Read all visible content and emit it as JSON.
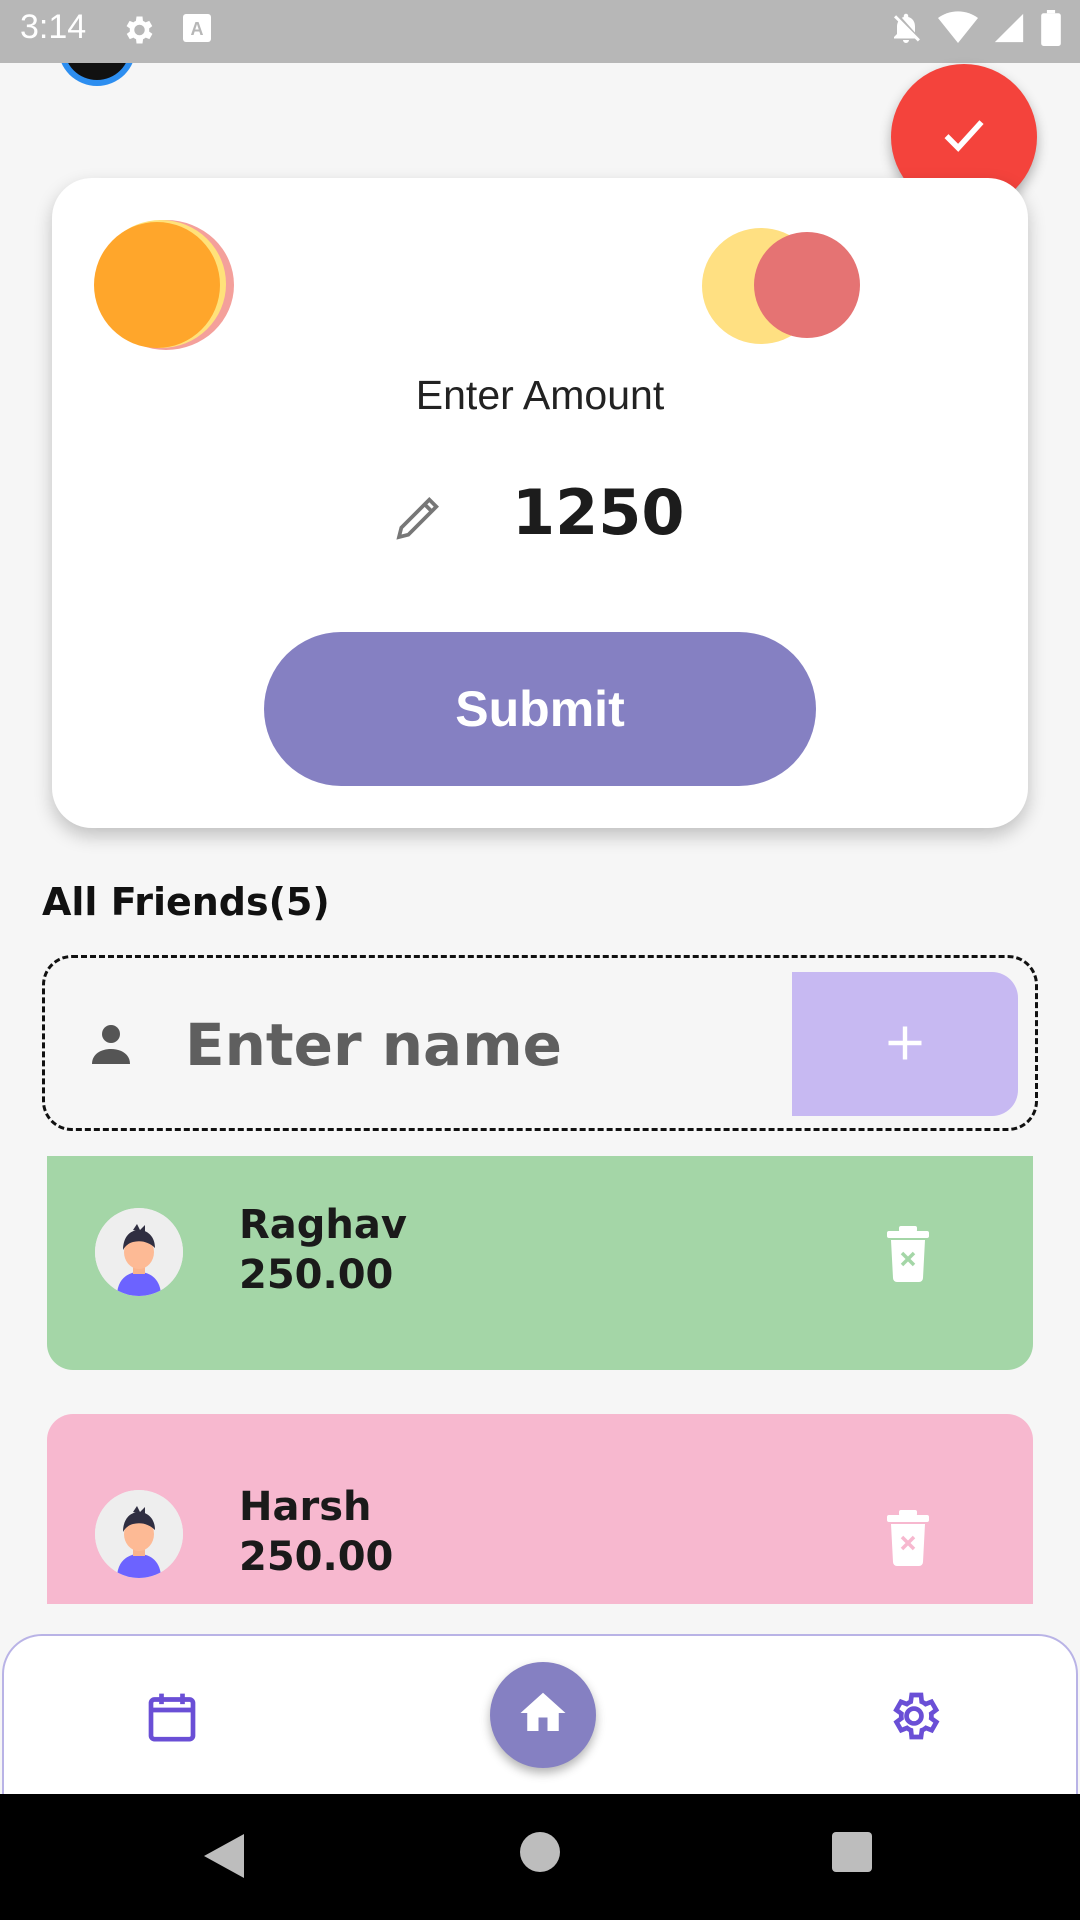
{
  "status_bar": {
    "time": "3:14",
    "icons_left": [
      "gear-icon",
      "keyboard-a-icon"
    ],
    "icons_right": [
      "bell-off-icon",
      "wifi-icon",
      "signal-icon",
      "battery-icon"
    ]
  },
  "fab": {
    "icon": "check-icon",
    "color": "#f4433c"
  },
  "amount_card": {
    "label": "Enter Amount",
    "value": "1250",
    "edit_icon": "pencil-icon",
    "submit_label": "Submit",
    "submit_color": "#8580c2"
  },
  "friends": {
    "title": "All Friends(5)",
    "input_placeholder": "Enter name",
    "input_icon": "person-icon",
    "add_icon": "plus-icon",
    "add_color": "#c7b9f2",
    "list": [
      {
        "name": "Raghav",
        "amount": "250.00",
        "color": "#a4d6a7"
      },
      {
        "name": "Harsh",
        "amount": "250.00",
        "color": "#f7b8cf"
      }
    ]
  },
  "bottom_nav": {
    "items": [
      "calendar-icon",
      "home-icon",
      "settings-icon"
    ],
    "active_color": "#8580c2",
    "icon_color": "#6a4fd6"
  },
  "system_nav": [
    "back-icon",
    "home-circle-icon",
    "recents-icon"
  ]
}
